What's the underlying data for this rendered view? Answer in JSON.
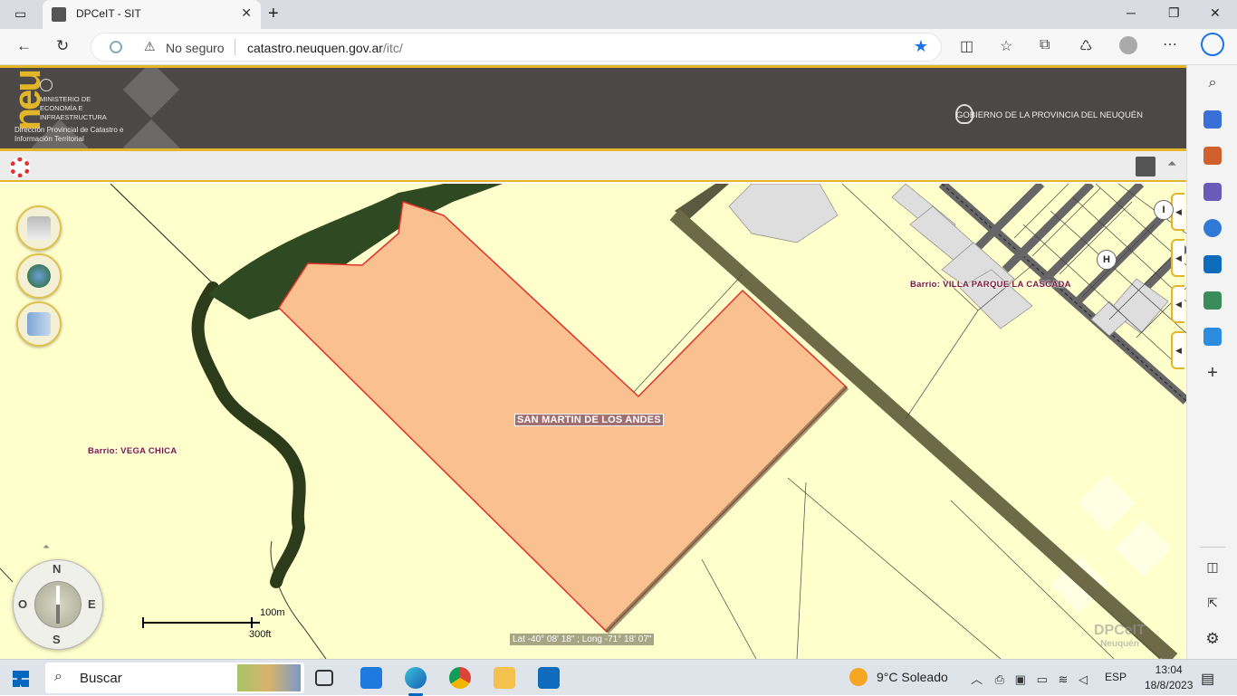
{
  "browser": {
    "tab_title": "DPCeIT - SIT",
    "close_tab": "✕",
    "new_tab": "+",
    "security_label": "No seguro",
    "url_host": "catastro.neuquen.gov.ar",
    "url_path": "/itc/",
    "win_min": "─",
    "win_max": "❐",
    "win_close": "✕"
  },
  "header": {
    "logo_text": "neu",
    "ministry_lines": "Ministerio de Economía e Infraestructura",
    "direction": "Dirección Provincial de Catastro e Información Territorial",
    "government": "GOBIERNO DE LA PROVINCIA DEL NEUQUÉN"
  },
  "map": {
    "parcel_label": "SAN MARTIN DE LOS ANDES",
    "barrio_east": "Barrio: VILLA PARQUE LA CASCADA",
    "barrio_west": "Barrio: VEGA CHICA",
    "poi_i": "I",
    "poi_h": "H",
    "compass": {
      "n": "N",
      "s": "S",
      "e": "E",
      "o": "O"
    },
    "scale_metric": "100m",
    "scale_imperial": "300ft",
    "coordinates": "Lat -40° 08' 18\" ; Long -71° 18' 07\"",
    "watermark": "DPCeIT",
    "watermark_sub": "Neuquén",
    "parcel_fill": "#fbc08f",
    "parcel_stroke": "#e0302a"
  },
  "taskbar": {
    "search_placeholder": "Buscar",
    "weather": "9°C  Soleado",
    "language": "ESP",
    "time": "13:04",
    "date": "18/8/2023"
  },
  "colors": {
    "header_bg": "#4b4847",
    "accent": "#e3b62a",
    "map_bg": "#ffffcc"
  }
}
